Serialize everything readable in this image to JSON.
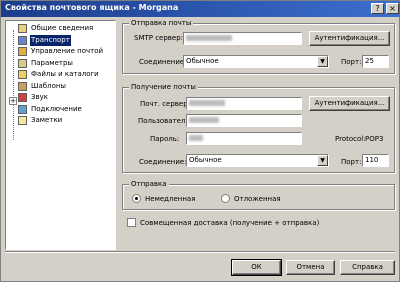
{
  "window": {
    "title": "Свойства почтового ящика - Morgana"
  },
  "tree": {
    "items": [
      {
        "label": "Общие сведения",
        "icon": "general-info-icon",
        "selected": false
      },
      {
        "label": "Транспорт",
        "icon": "transport-icon",
        "selected": true
      },
      {
        "label": "Управление почтой",
        "icon": "mail-management-icon",
        "selected": false
      },
      {
        "label": "Параметры",
        "icon": "parameters-icon",
        "selected": false
      },
      {
        "label": "Файлы и каталоги",
        "icon": "files-folders-icon",
        "selected": false
      },
      {
        "label": "Шаблоны",
        "icon": "templates-icon",
        "selected": false
      },
      {
        "label": "Звук",
        "icon": "sound-icon",
        "selected": false
      },
      {
        "label": "Подключение",
        "icon": "connection-icon",
        "selected": false
      },
      {
        "label": "Заметки",
        "icon": "notes-icon",
        "selected": false
      }
    ]
  },
  "send": {
    "title": "Отправка почты",
    "smtp_label": "SMTP сервер:",
    "auth_button": "Аутентификация...",
    "conn_label": "Соединение:",
    "conn_value": "Обычное",
    "port_label": "Порт:",
    "port_value": "25"
  },
  "receive": {
    "title": "Получение почты",
    "server_label": "Почт. сервер:",
    "auth_button": "Аутентификация...",
    "user_label": "Пользователь:",
    "password_label": "Пароль:",
    "protocol_label": "Protocol:",
    "protocol_value": "POP3",
    "conn_label": "Соединение:",
    "conn_value": "Обычное",
    "port_label": "Порт:",
    "port_value": "110"
  },
  "dispatch": {
    "title": "Отправка",
    "immediate": "Немедленная",
    "deferred": "Отложенная",
    "selected": "immediate"
  },
  "combined": {
    "label": "Совмещенная доставка (получение + отправка)",
    "checked": false
  },
  "buttons": {
    "ok": "ОК",
    "cancel": "Отмена",
    "help": "Справка"
  },
  "titlebar_buttons": {
    "help": "?",
    "close": "×"
  }
}
